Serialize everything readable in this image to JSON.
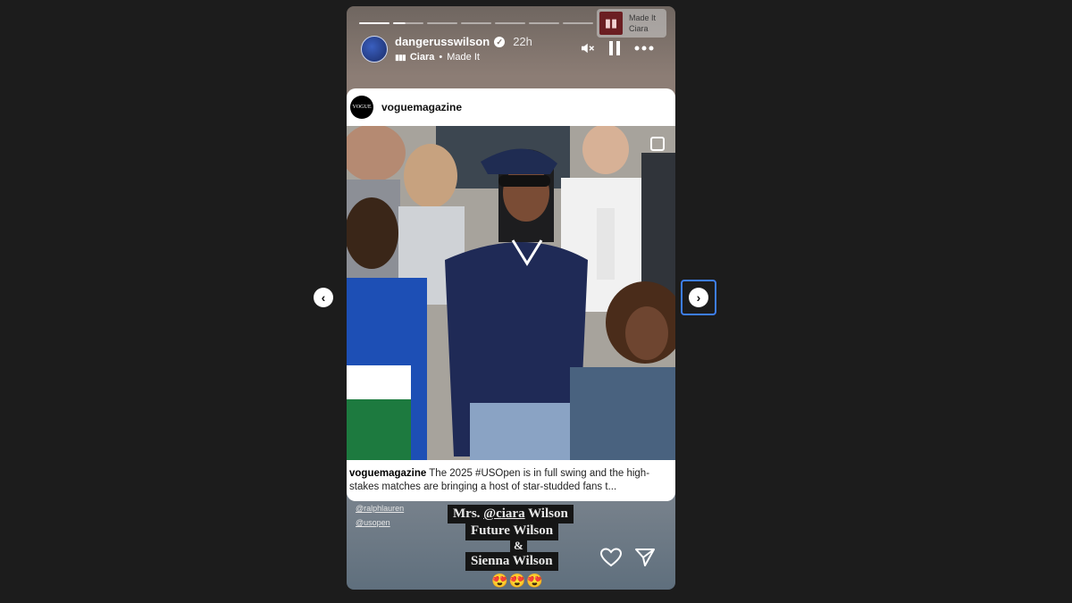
{
  "story": {
    "username": "dangerusswilson",
    "time": "22h",
    "song_artist": "Ciara",
    "song_separator": "•",
    "song_title": "Made It",
    "music_chip": {
      "title": "Made It",
      "artist": "Ciara"
    },
    "progress_segments": 9,
    "progress_completed": 1.4
  },
  "controls": {
    "mute_icon": "speaker-muted-icon",
    "pause_icon": "pause-icon",
    "more_icon": "more-dots-icon"
  },
  "post": {
    "username": "vogue magazine",
    "header_username": "voguemagazine",
    "logo_text": "VOGUE",
    "caption_user": "voguemagazine",
    "caption_text": " The 2025 #USOpen is in full swing and the high-stakes matches are bringing a host of star-studded fans t..."
  },
  "tags": [
    "@ralphlauren",
    "@usopen"
  ],
  "stickers": {
    "line1_prefix": "Mrs. ",
    "line1_mention": "@ciara",
    "line1_suffix": " Wilson",
    "line2": "Future Wilson",
    "line3": "&",
    "line4": "Sienna Wilson",
    "emojis": "😍😍😍"
  },
  "nav": {
    "prev": "‹",
    "next": "›"
  }
}
